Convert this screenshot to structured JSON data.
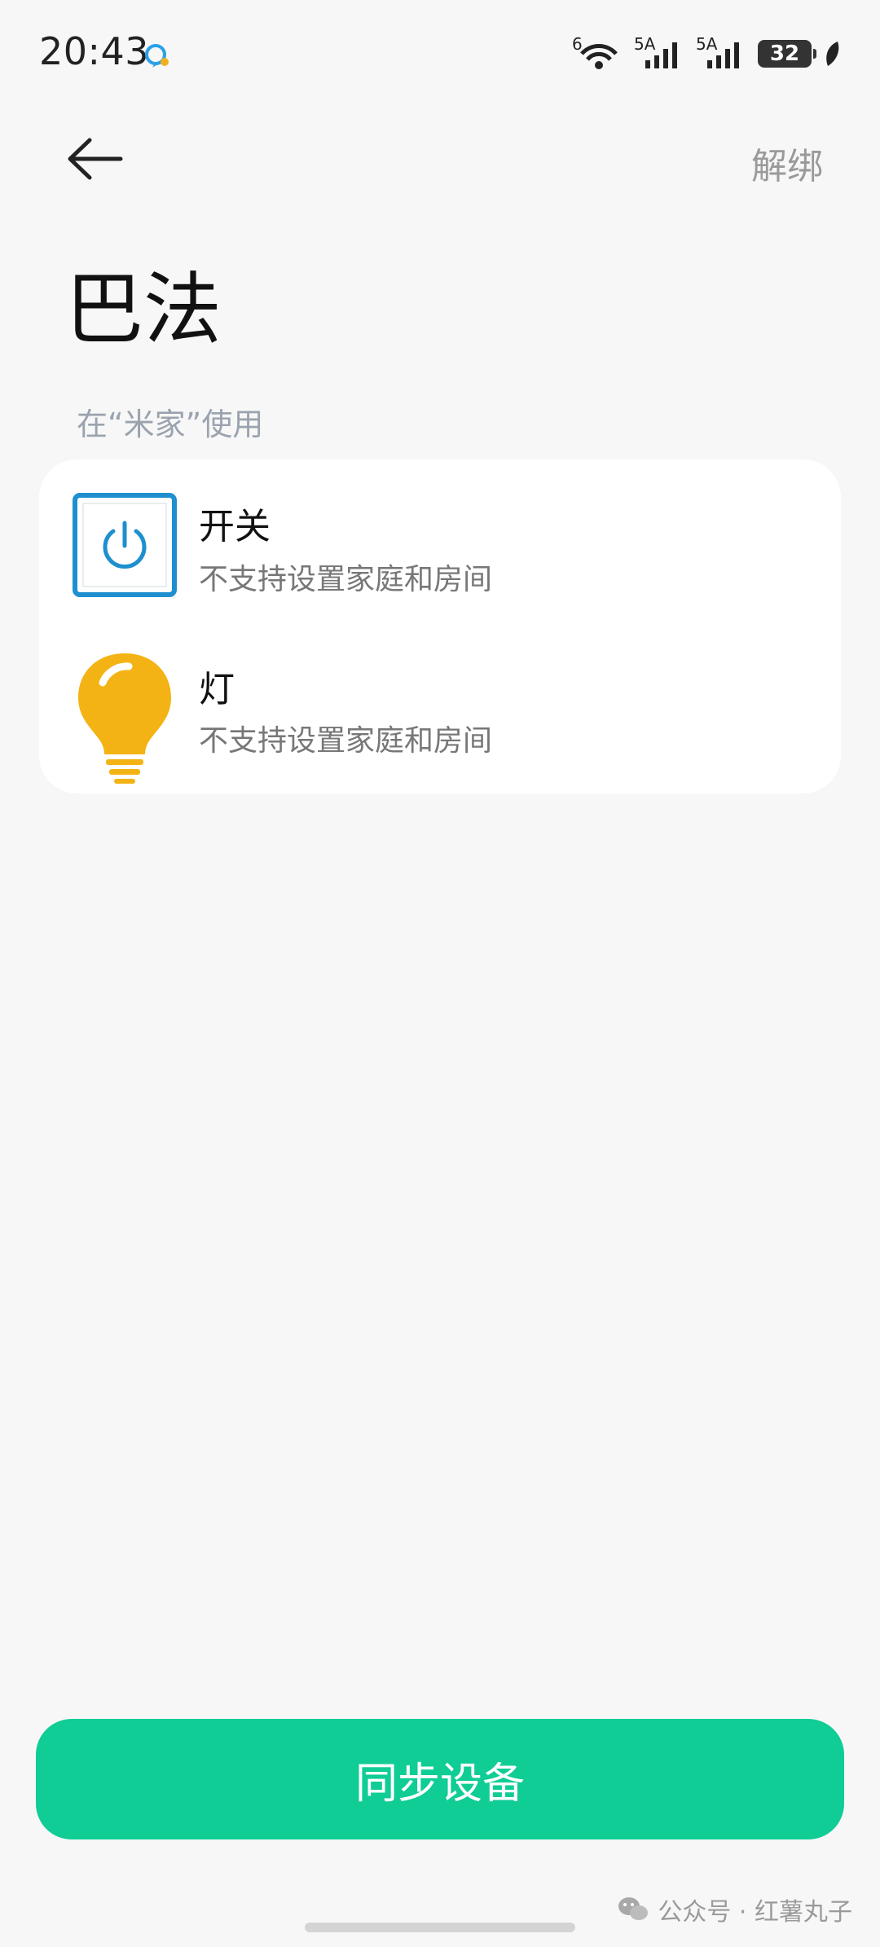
{
  "status_bar": {
    "time": "20:43",
    "wifi_label": "6",
    "signal1_label": "5A",
    "signal2_label": "5A",
    "battery": "32"
  },
  "header": {
    "unbind_label": "解绑"
  },
  "page": {
    "title": "巴法",
    "section_label": "在“米家”使用"
  },
  "devices": [
    {
      "name": "开关",
      "desc": "不支持设置家庭和房间",
      "icon": "power-switch-icon"
    },
    {
      "name": "灯",
      "desc": "不支持设置家庭和房间",
      "icon": "light-bulb-icon"
    }
  ],
  "footer": {
    "sync_label": "同步设备",
    "watermark": "公众号 · 红薯丸子"
  },
  "colors": {
    "accent": "#0fcd95",
    "switch_blue": "#1e8fcf",
    "bulb_yellow": "#f4b315"
  }
}
